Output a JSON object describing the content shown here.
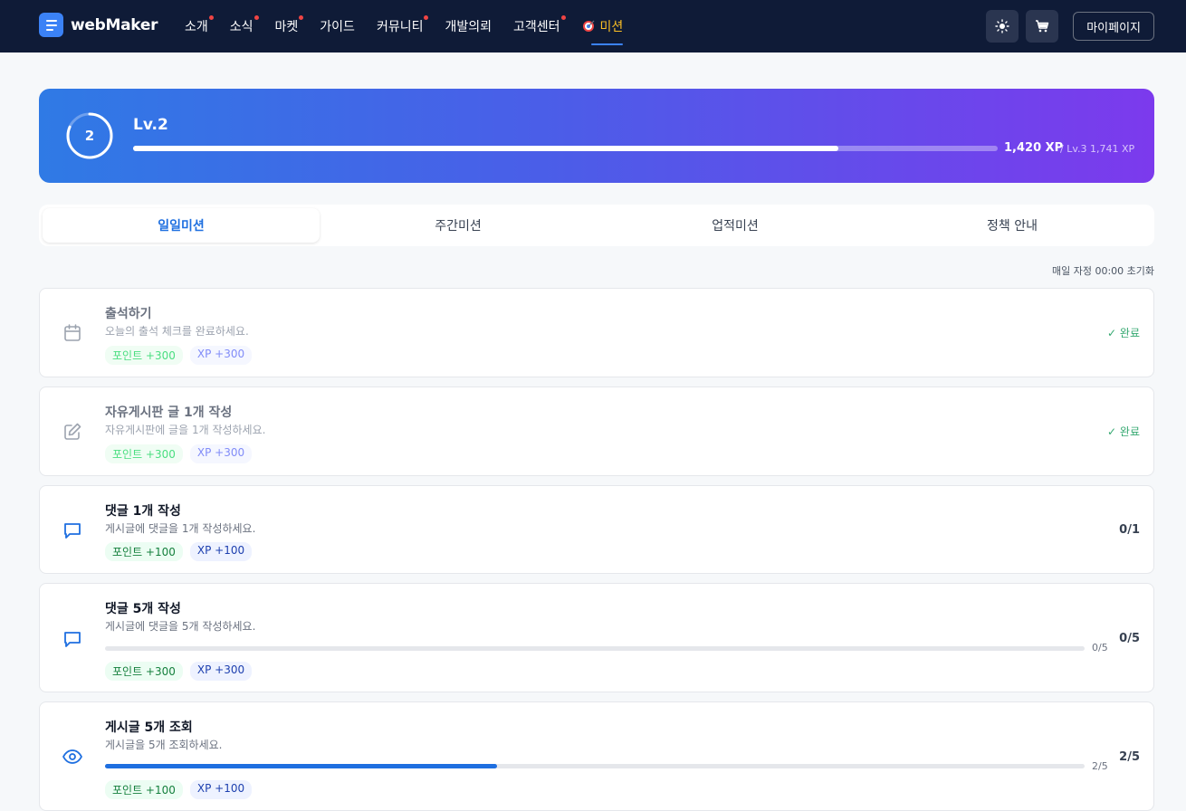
{
  "brand": {
    "name": "webMaker"
  },
  "nav": {
    "items": [
      {
        "label": "소개",
        "dot": true
      },
      {
        "label": "소식",
        "dot": true
      },
      {
        "label": "마켓",
        "dot": true
      },
      {
        "label": "가이드",
        "dot": false
      },
      {
        "label": "커뮤니티",
        "dot": true
      },
      {
        "label": "개발의뢰",
        "dot": false
      },
      {
        "label": "고객센터",
        "dot": true
      }
    ],
    "active_item": {
      "label": "미션",
      "icon": "target-icon"
    },
    "theme_icon": "sun-icon",
    "cart_icon": "cart-icon",
    "mypage_label": "마이페이지"
  },
  "level": {
    "number": "2",
    "title": "Lv.2",
    "progress_fraction": 0.8156,
    "current_xp": "1,420 XP",
    "next_level": "/ Lv.3 1,741 XP"
  },
  "tabs": [
    "일일미션",
    "주간미션",
    "업적미션",
    "정책 안내"
  ],
  "active_tab": 0,
  "reset_note": "매일 자정 00:00 초기화",
  "missions": [
    {
      "icon": "calendar-icon",
      "title": "출석하기",
      "desc": "오늘의 출석 체크를 완료하세요.",
      "points": "포인트 +300",
      "xp": "XP +300",
      "status": "완료",
      "done": true
    },
    {
      "icon": "edit-icon",
      "title": "자유게시판 글 1개 작성",
      "desc": "자유게시판에 글을 1개 작성하세요.",
      "points": "포인트 +300",
      "xp": "XP +300",
      "status": "완료",
      "done": true
    },
    {
      "icon": "comment-icon",
      "title": "댓글 1개 작성",
      "desc": "게시글에 댓글을 1개 작성하세요.",
      "points": "포인트 +100",
      "xp": "XP +100",
      "status": "0/1",
      "done": false
    },
    {
      "icon": "comment-icon",
      "title": "댓글 5개 작성",
      "desc": "게시글에 댓글을 5개 작성하세요.",
      "points": "포인트 +300",
      "xp": "XP +300",
      "status": "0/5",
      "progress_label": "0/5",
      "progress_fraction": 0.0,
      "done": false
    },
    {
      "icon": "eye-icon",
      "title": "게시글 5개 조회",
      "desc": "게시글을 5개 조회하세요.",
      "points": "포인트 +100",
      "xp": "XP +100",
      "status": "2/5",
      "progress_label": "2/5",
      "progress_fraction": 0.4,
      "done": false
    }
  ]
}
